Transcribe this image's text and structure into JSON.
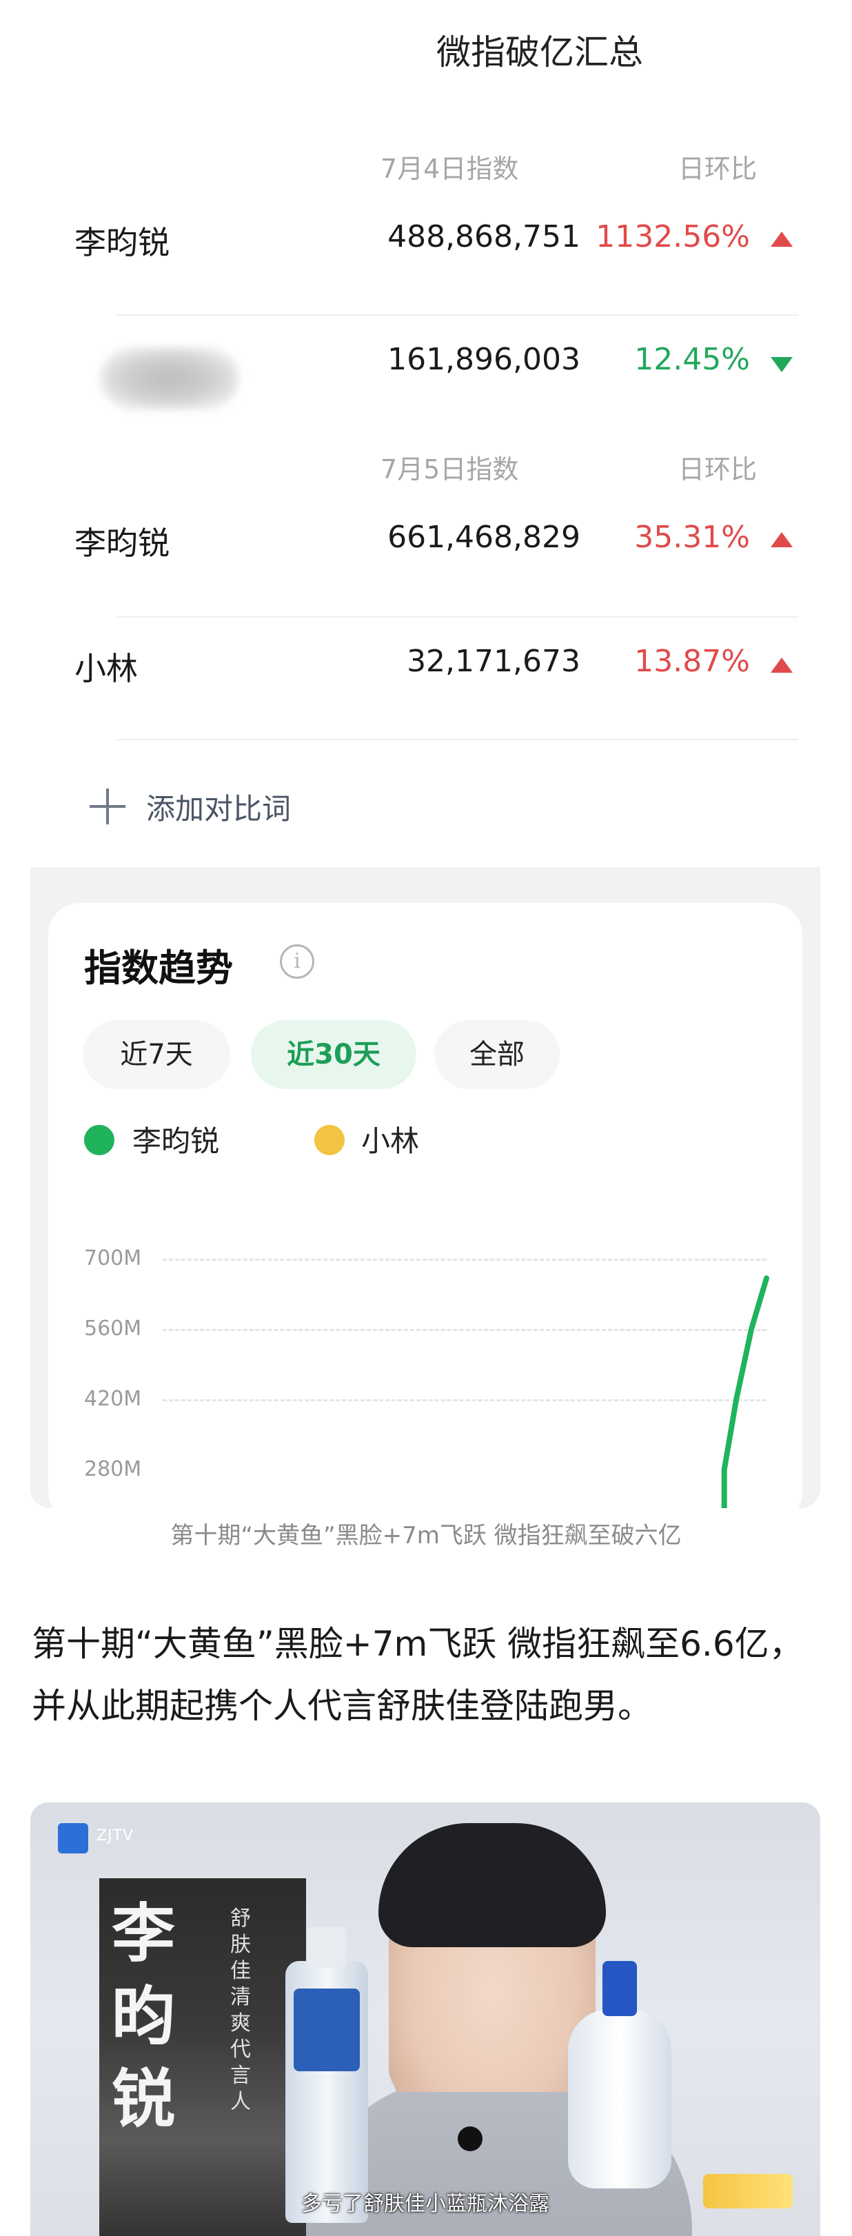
{
  "page": {
    "title": "微指破亿汇总"
  },
  "section1": {
    "index_label": "7月4日指数",
    "ratio_label": "日环比",
    "rows": [
      {
        "name": "李昀锐",
        "value": "488,868,751",
        "change": "1132.56%",
        "direction": "up"
      },
      {
        "name": "",
        "value": "161,896,003",
        "change": "12.45%",
        "direction": "down"
      }
    ]
  },
  "section2": {
    "index_label": "7月5日指数",
    "ratio_label": "日环比",
    "rows": [
      {
        "name": "李昀锐",
        "value": "661,468,829",
        "change": "35.31%",
        "direction": "up"
      },
      {
        "name": "小林",
        "value": "32,171,673",
        "change": "13.87%",
        "direction": "up"
      }
    ]
  },
  "add_compare": {
    "label": "添加对比词",
    "icon": "plus-icon"
  },
  "trend": {
    "title": "指数趋势",
    "info_icon": "info-icon",
    "ranges": [
      "近7天",
      "近30天",
      "全部"
    ],
    "selected_range": "近30天",
    "legend": [
      {
        "name": "李昀锐",
        "color": "#1fb45c"
      },
      {
        "name": "小林",
        "color": "#f3c443"
      }
    ]
  },
  "chart_data": {
    "type": "line",
    "title": "",
    "xlabel": "",
    "ylabel": "",
    "y_ticks": [
      "700M",
      "560M",
      "420M"
    ],
    "ylim": [
      280,
      700
    ],
    "series": [
      {
        "name": "李昀锐",
        "color": "#1fb45c",
        "x": [
          0.93,
          0.95,
          0.975,
          1.0
        ],
        "values": [
          280,
          420,
          560,
          661
        ]
      }
    ],
    "grid": true
  },
  "caption": "第十期“大黄鱼”黑脸+7m飞跃 微指狂飙至破六亿",
  "body_text": "第十期“大黄鱼”黑脸+7m飞跃 微指狂飙至6.6亿，并从此期起携个人代言舒肤佳登陆跑男。",
  "photo": {
    "subtitle": "多亏了舒肤佳小蓝瓶沐浴露",
    "poster_name": "李昀锐",
    "poster_vertical": "舒肤佳清爽代言人",
    "channel_logo": "ZJTV"
  },
  "colors": {
    "up": "#e14a4a",
    "down": "#22a85a",
    "accent_green": "#1c9e57"
  }
}
